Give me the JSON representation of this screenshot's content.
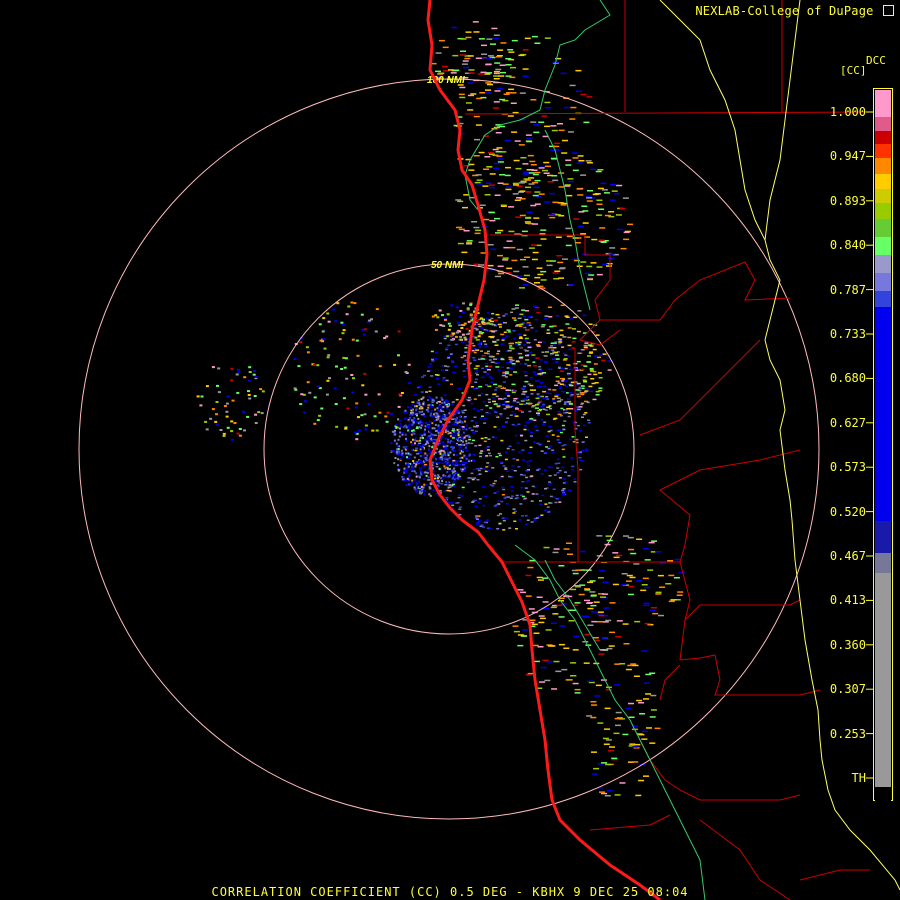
{
  "window": {
    "credit": "NEXLAB-College of DuPage",
    "credit_icon": "external-link-icon",
    "caption": "CORRELATION COEFFICIENT (CC) 0.5 DEG - KBHX 9 DEC 25 08:04"
  },
  "radar": {
    "site": "KBHX",
    "product": "CORRELATION COEFFICIENT (CC)",
    "elevation": "0.5 DEG",
    "date": "9 DEC 25",
    "time": "08:04",
    "range_rings": [
      {
        "label": "50 NMI"
      },
      {
        "label": "100 NMI"
      }
    ]
  },
  "color_scale": {
    "product_code": "DCC",
    "units": "[CC]",
    "ticks": [
      "1.000",
      "0.947",
      "0.893",
      "0.840",
      "0.787",
      "0.733",
      "0.680",
      "0.627",
      "0.573",
      "0.520",
      "0.467",
      "0.413",
      "0.360",
      "0.307",
      "0.253",
      "TH"
    ],
    "segments": [
      {
        "color": "#ff99cc"
      },
      {
        "color": "#e05a8a"
      },
      {
        "color": "#cc0000"
      },
      {
        "color": "#ff3300"
      },
      {
        "color": "#ff8800"
      },
      {
        "color": "#ffcc00"
      },
      {
        "color": "#cccc00"
      },
      {
        "color": "#99cc00"
      },
      {
        "color": "#66cc33"
      },
      {
        "color": "#66ff66"
      },
      {
        "color": "#9999cc"
      },
      {
        "color": "#7777dd"
      },
      {
        "color": "#3344dd"
      },
      {
        "color": "#0000ee"
      },
      {
        "color": "#1a1aaa"
      },
      {
        "color": "#777799"
      },
      {
        "color": "#999999"
      },
      {
        "color": "#000000"
      }
    ]
  },
  "colors": {
    "background": "#000000",
    "label_yellow": "#ffff33",
    "ring": "#ffbbbb",
    "coastline": "#ff0000",
    "state_border": "#ffff66",
    "county_lines": "#cc0000",
    "terrain_lines": "#33cc66"
  }
}
